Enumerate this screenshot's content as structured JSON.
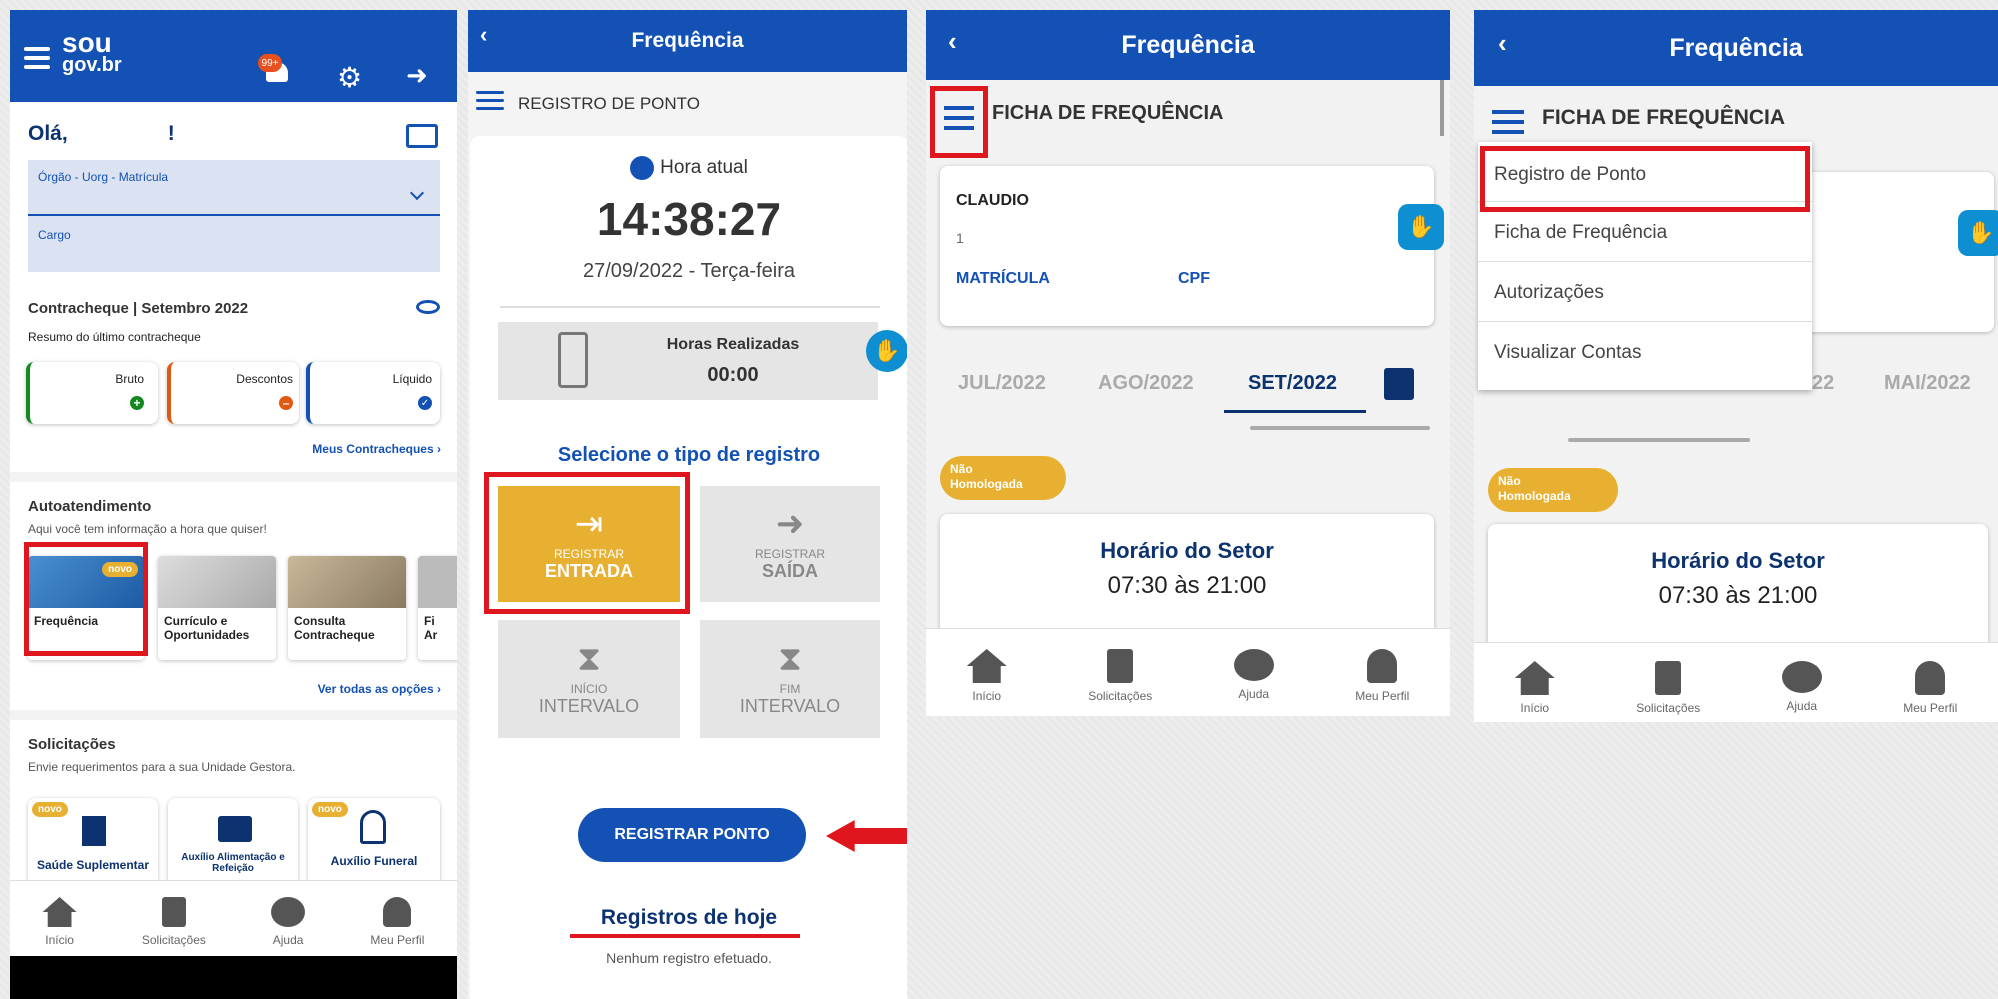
{
  "p1": {
    "logo_top": "sou",
    "logo_bottom": "gov.br",
    "notif_count": "99+",
    "greeting": "Olá,",
    "greeting_end": "!",
    "select_label": "Órgão - Uorg - Matrícula",
    "cargo_label": "Cargo",
    "contracheque_title": "Contracheque | Setembro 2022",
    "contracheque_sub": "Resumo do último contracheque",
    "bruto": "Bruto",
    "descontos": "Descontos",
    "liquido": "Líquido",
    "meus_contracheques": "Meus Contracheques",
    "auto_title": "Autoatendimento",
    "auto_sub": "Aqui você tem informação a hora que quiser!",
    "cards": [
      {
        "label": "Frequência",
        "badge": "novo"
      },
      {
        "label": "Currículo e Oportunidades"
      },
      {
        "label": "Consulta Contracheque"
      },
      {
        "label": "Fi Ar"
      }
    ],
    "ver_todas": "Ver todas as opções",
    "sol_title": "Solicitações",
    "sol_sub": "Envie requerimentos para a sua Unidade Gestora.",
    "sol_cards": [
      {
        "label": "Saúde Suplementar",
        "badge": "novo"
      },
      {
        "label": "Auxílio Alimentação e Refeição"
      },
      {
        "label": "Auxílio Funeral",
        "badge": "novo"
      }
    ]
  },
  "tabs": [
    "Início",
    "Solicitações",
    "Ajuda",
    "Meu Perfil"
  ],
  "freq_title": "Frequência",
  "p2": {
    "section": "REGISTRO DE PONTO",
    "hora_atual": "Hora atual",
    "time": "14:38:27",
    "date": "27/09/2022 - Terça-feira",
    "horas_label": "Horas Realizadas",
    "horas_value": "00:00",
    "selecione": "Selecione o tipo de registro",
    "btn_entrada_top": "REGISTRAR",
    "btn_entrada_bottom": "ENTRADA",
    "btn_saida_top": "REGISTRAR",
    "btn_saida_bottom": "SAÍDA",
    "btn_inicio_top": "INÍCIO",
    "btn_inicio_bottom": "INTERVALO",
    "btn_fim_top": "FIM",
    "btn_fim_bottom": "INTERVALO",
    "registrar_ponto": "REGISTRAR PONTO",
    "registros_hoje": "Registros de hoje",
    "nenhum": "Nenhum registro efetuado."
  },
  "p3": {
    "section": "FICHA DE FREQUÊNCIA",
    "name": "CLAUDIO",
    "num": "1",
    "matricula": "MATRÍCULA",
    "cpf": "CPF",
    "months": [
      "JUL/2022",
      "AGO/2022",
      "SET/2022"
    ],
    "badge_l1": "Não",
    "badge_l2": "Homologada",
    "horario_title": "Horário do Setor",
    "horario": "07:30 às 21:00"
  },
  "p4": {
    "section": "FICHA DE FREQUÊNCIA",
    "menu": [
      "Registro de Ponto",
      "Ficha de Frequência",
      "Autorizações",
      "Visualizar Contas"
    ],
    "month_partial": "22",
    "month_mai": "MAI/2022",
    "badge_l1": "Não",
    "badge_l2": "Homologada",
    "horario_title": "Horário do Setor",
    "horario": "07:30 às 21:00"
  }
}
